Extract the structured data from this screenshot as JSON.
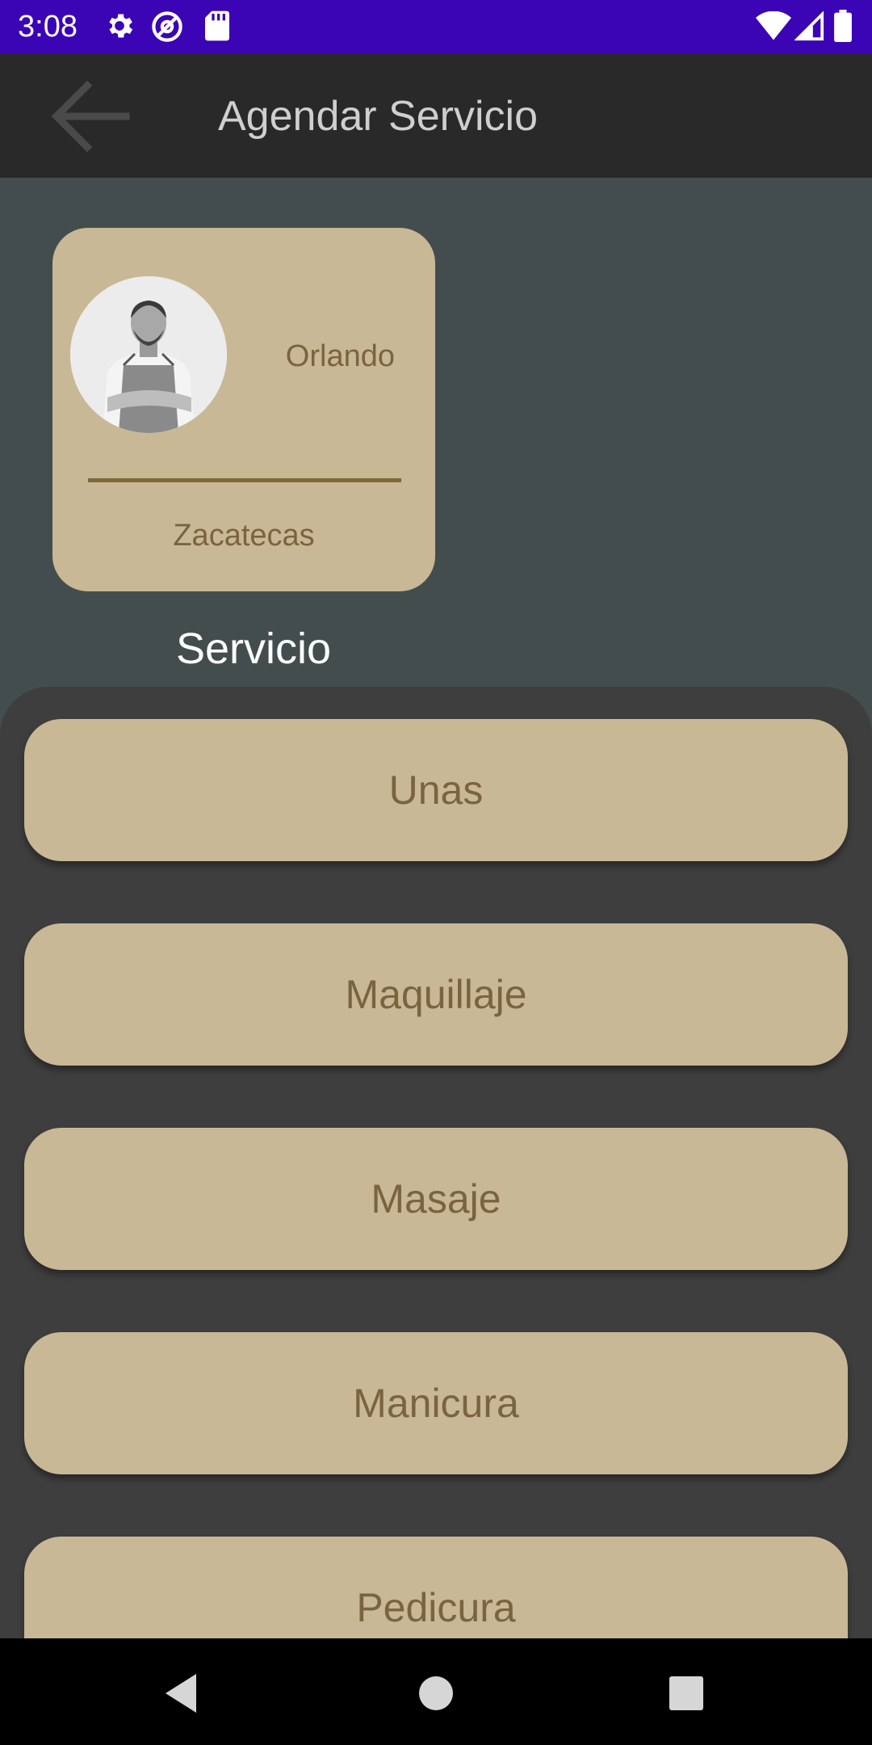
{
  "status_bar": {
    "time": "3:08",
    "icons_left": [
      "gear-icon",
      "at-sign-icon",
      "sd-card-icon"
    ],
    "icons_right": [
      "wifi-icon",
      "cellular-signal-icon",
      "battery-icon"
    ]
  },
  "app_bar": {
    "title": "Agendar Servicio",
    "back_icon": "arrow-left-icon"
  },
  "stylist_card": {
    "name": "Orlando",
    "location": "Zacatecas",
    "avatar": "profile-photo"
  },
  "section": {
    "title": "Servicio"
  },
  "services": [
    {
      "label": "Unas"
    },
    {
      "label": "Maquillaje"
    },
    {
      "label": "Masaje"
    },
    {
      "label": "Manicura"
    },
    {
      "label": "Pedicura"
    }
  ],
  "nav_bar": {
    "buttons": [
      "back-triangle-icon",
      "home-circle-icon",
      "recents-square-icon"
    ]
  },
  "colors": {
    "status_bar": "#3b04b5",
    "app_bar": "#292929",
    "background": "#444d4d",
    "panel": "#3e3e3f",
    "card": "#c9b895",
    "card_text": "#7a6440"
  }
}
